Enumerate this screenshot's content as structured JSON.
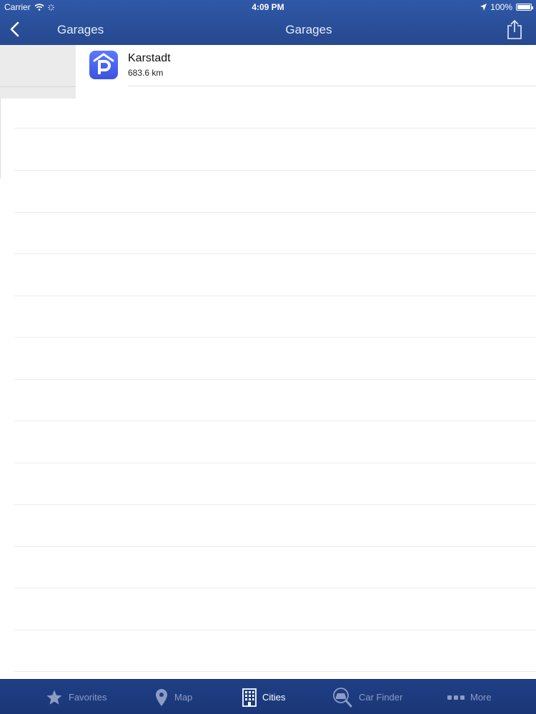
{
  "status_bar": {
    "carrier": "Carrier",
    "time": "4:09 PM",
    "battery_text": "100%"
  },
  "nav": {
    "back_label": "Garages",
    "title": "Garages"
  },
  "garages": [
    {
      "name": "Karstadt",
      "distance": "683.6 km",
      "icon": "parking-garage-icon"
    }
  ],
  "tabs": [
    {
      "label": "Favorites",
      "icon": "star-icon",
      "active": false
    },
    {
      "label": "Map",
      "icon": "map-pin-icon",
      "active": false
    },
    {
      "label": "Cities",
      "icon": "building-icon",
      "active": true
    },
    {
      "label": "Car Finder",
      "icon": "car-finder-icon",
      "active": false
    },
    {
      "label": "More",
      "icon": "more-dots-icon",
      "active": false
    }
  ],
  "colors": {
    "header_blue": "#2f59a8",
    "tab_bar_blue": "#1f3f86",
    "garage_icon": "#4a63f0"
  }
}
